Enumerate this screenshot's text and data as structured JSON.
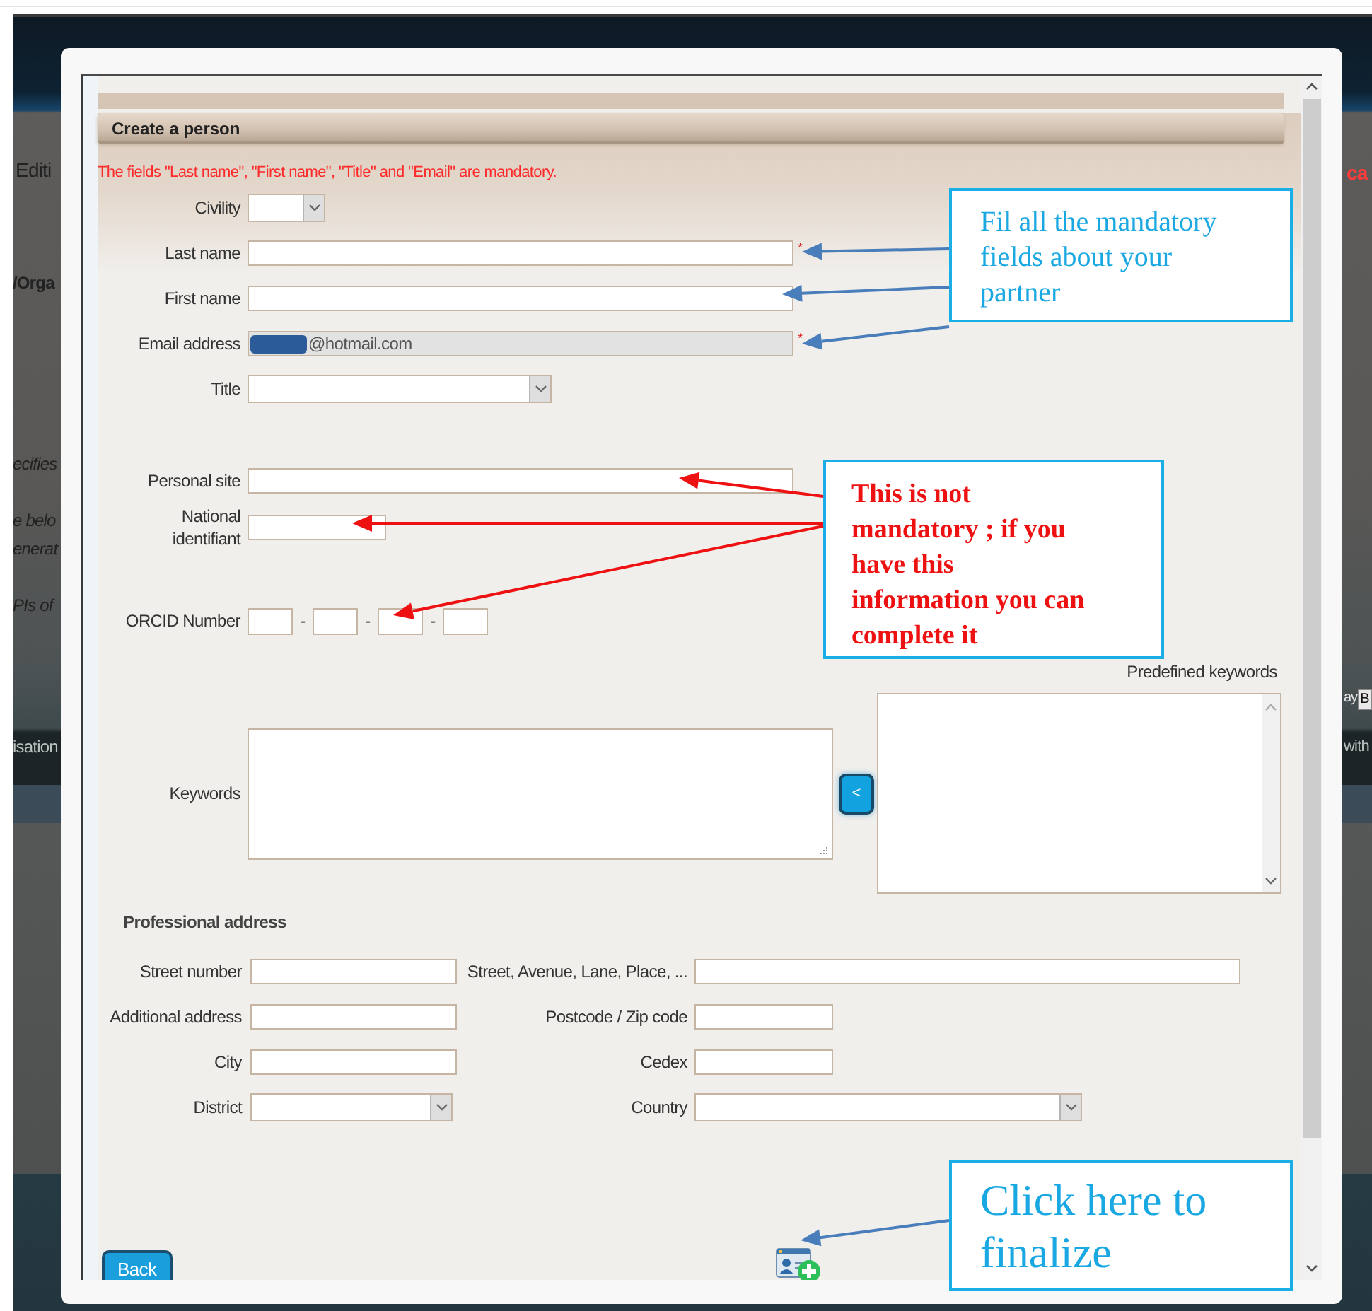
{
  "backdrop": {
    "left_fragments": [
      {
        "kind": "plain",
        "text": "Editi"
      },
      {
        "kind": "bold",
        "text": "/Orga"
      },
      {
        "kind": "italic",
        "text": "ecifies"
      },
      {
        "kind": "italic",
        "text": "e belo"
      },
      {
        "kind": "italic",
        "text": "enerat"
      },
      {
        "kind": "italic",
        "text": "PIs of"
      },
      {
        "kind": "dim",
        "text": "isation"
      }
    ],
    "right_fragments": [
      {
        "kind": "alert",
        "text": "ca"
      },
      {
        "kind": "plain",
        "text": "ay"
      },
      {
        "kind": "select",
        "text": "B"
      },
      {
        "kind": "dim",
        "text": "with"
      }
    ]
  },
  "dialog": {
    "title": "Create a person",
    "note": "The fields \"Last name\", \"First name\", \"Title\" and \"Email\" are mandatory.",
    "fields": [
      {
        "kind": "select",
        "label": "Civility"
      },
      {
        "kind": "text",
        "label": "Last name",
        "required_mark": "*"
      },
      {
        "kind": "text",
        "label": "First name"
      },
      {
        "kind": "email",
        "label": "Email address",
        "value": "@hotmail.com",
        "disabled": true,
        "redacted": true,
        "required_mark": "*"
      },
      {
        "kind": "select",
        "label": "Title"
      },
      {
        "kind": "text",
        "label": "Personal site"
      },
      {
        "kind": "text",
        "label": "National identifiant"
      },
      {
        "kind": "orcid",
        "label": "ORCID Number",
        "separators": [
          "-",
          "-",
          "-"
        ]
      }
    ],
    "keywords": {
      "label": "Keywords",
      "predefined_label": "Predefined keywords",
      "move_button": "<"
    },
    "address": {
      "heading": "Professional address",
      "rows": [
        [
          {
            "kind": "text",
            "label": "Street number"
          },
          {
            "kind": "text",
            "label": "Street, Avenue, Lane, Place, ..."
          }
        ],
        [
          {
            "kind": "text",
            "label": "Additional address"
          },
          {
            "kind": "text",
            "label": "Postcode / Zip code"
          }
        ],
        [
          {
            "kind": "text",
            "label": "City"
          },
          {
            "kind": "text",
            "label": "Cedex"
          }
        ],
        [
          {
            "kind": "select",
            "label": "District"
          },
          {
            "kind": "select",
            "label": "Country"
          }
        ]
      ]
    },
    "back_button": "Back"
  },
  "callouts": [
    {
      "kind": "info",
      "text": "Fil all the mandatory fields about your partner"
    },
    {
      "kind": "warning",
      "text": "This is not mandatory ; if you have this information you can complete it"
    },
    {
      "kind": "info",
      "text": "Click here to finalize"
    }
  ]
}
